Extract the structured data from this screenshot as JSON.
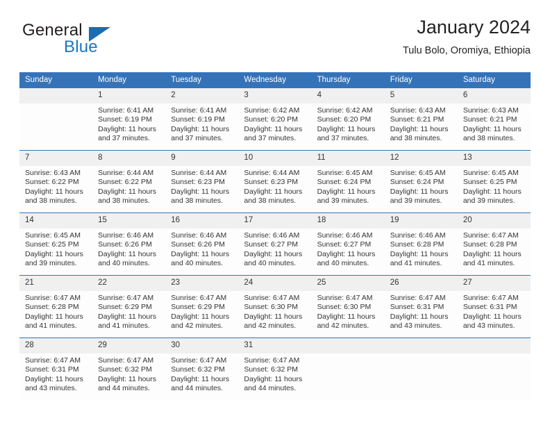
{
  "brand": {
    "word_one": "General",
    "word_two": "Blue",
    "icon": "triangle-logo-icon"
  },
  "header": {
    "title": "January 2024",
    "subtitle": "Tulu Bolo, Oromiya, Ethiopia"
  },
  "colors": {
    "header_blue": "#3573b9",
    "brand_blue": "#1b75bb",
    "daynum_band": "#f0f0f0",
    "text": "#333333"
  },
  "weekday_headers": [
    "Sunday",
    "Monday",
    "Tuesday",
    "Wednesday",
    "Thursday",
    "Friday",
    "Saturday"
  ],
  "labels": {
    "sunrise_prefix": "Sunrise:",
    "sunset_prefix": "Sunset:",
    "daylight_prefix": "Daylight:"
  },
  "weeks": [
    [
      {
        "day": "",
        "sunrise": "",
        "sunset": "",
        "daylight_line1": "",
        "daylight_line2": ""
      },
      {
        "day": "1",
        "sunrise": "Sunrise: 6:41 AM",
        "sunset": "Sunset: 6:19 PM",
        "daylight_line1": "Daylight: 11 hours",
        "daylight_line2": "and 37 minutes."
      },
      {
        "day": "2",
        "sunrise": "Sunrise: 6:41 AM",
        "sunset": "Sunset: 6:19 PM",
        "daylight_line1": "Daylight: 11 hours",
        "daylight_line2": "and 37 minutes."
      },
      {
        "day": "3",
        "sunrise": "Sunrise: 6:42 AM",
        "sunset": "Sunset: 6:20 PM",
        "daylight_line1": "Daylight: 11 hours",
        "daylight_line2": "and 37 minutes."
      },
      {
        "day": "4",
        "sunrise": "Sunrise: 6:42 AM",
        "sunset": "Sunset: 6:20 PM",
        "daylight_line1": "Daylight: 11 hours",
        "daylight_line2": "and 37 minutes."
      },
      {
        "day": "5",
        "sunrise": "Sunrise: 6:43 AM",
        "sunset": "Sunset: 6:21 PM",
        "daylight_line1": "Daylight: 11 hours",
        "daylight_line2": "and 38 minutes."
      },
      {
        "day": "6",
        "sunrise": "Sunrise: 6:43 AM",
        "sunset": "Sunset: 6:21 PM",
        "daylight_line1": "Daylight: 11 hours",
        "daylight_line2": "and 38 minutes."
      }
    ],
    [
      {
        "day": "7",
        "sunrise": "Sunrise: 6:43 AM",
        "sunset": "Sunset: 6:22 PM",
        "daylight_line1": "Daylight: 11 hours",
        "daylight_line2": "and 38 minutes."
      },
      {
        "day": "8",
        "sunrise": "Sunrise: 6:44 AM",
        "sunset": "Sunset: 6:22 PM",
        "daylight_line1": "Daylight: 11 hours",
        "daylight_line2": "and 38 minutes."
      },
      {
        "day": "9",
        "sunrise": "Sunrise: 6:44 AM",
        "sunset": "Sunset: 6:23 PM",
        "daylight_line1": "Daylight: 11 hours",
        "daylight_line2": "and 38 minutes."
      },
      {
        "day": "10",
        "sunrise": "Sunrise: 6:44 AM",
        "sunset": "Sunset: 6:23 PM",
        "daylight_line1": "Daylight: 11 hours",
        "daylight_line2": "and 38 minutes."
      },
      {
        "day": "11",
        "sunrise": "Sunrise: 6:45 AM",
        "sunset": "Sunset: 6:24 PM",
        "daylight_line1": "Daylight: 11 hours",
        "daylight_line2": "and 39 minutes."
      },
      {
        "day": "12",
        "sunrise": "Sunrise: 6:45 AM",
        "sunset": "Sunset: 6:24 PM",
        "daylight_line1": "Daylight: 11 hours",
        "daylight_line2": "and 39 minutes."
      },
      {
        "day": "13",
        "sunrise": "Sunrise: 6:45 AM",
        "sunset": "Sunset: 6:25 PM",
        "daylight_line1": "Daylight: 11 hours",
        "daylight_line2": "and 39 minutes."
      }
    ],
    [
      {
        "day": "14",
        "sunrise": "Sunrise: 6:45 AM",
        "sunset": "Sunset: 6:25 PM",
        "daylight_line1": "Daylight: 11 hours",
        "daylight_line2": "and 39 minutes."
      },
      {
        "day": "15",
        "sunrise": "Sunrise: 6:46 AM",
        "sunset": "Sunset: 6:26 PM",
        "daylight_line1": "Daylight: 11 hours",
        "daylight_line2": "and 40 minutes."
      },
      {
        "day": "16",
        "sunrise": "Sunrise: 6:46 AM",
        "sunset": "Sunset: 6:26 PM",
        "daylight_line1": "Daylight: 11 hours",
        "daylight_line2": "and 40 minutes."
      },
      {
        "day": "17",
        "sunrise": "Sunrise: 6:46 AM",
        "sunset": "Sunset: 6:27 PM",
        "daylight_line1": "Daylight: 11 hours",
        "daylight_line2": "and 40 minutes."
      },
      {
        "day": "18",
        "sunrise": "Sunrise: 6:46 AM",
        "sunset": "Sunset: 6:27 PM",
        "daylight_line1": "Daylight: 11 hours",
        "daylight_line2": "and 40 minutes."
      },
      {
        "day": "19",
        "sunrise": "Sunrise: 6:46 AM",
        "sunset": "Sunset: 6:28 PM",
        "daylight_line1": "Daylight: 11 hours",
        "daylight_line2": "and 41 minutes."
      },
      {
        "day": "20",
        "sunrise": "Sunrise: 6:47 AM",
        "sunset": "Sunset: 6:28 PM",
        "daylight_line1": "Daylight: 11 hours",
        "daylight_line2": "and 41 minutes."
      }
    ],
    [
      {
        "day": "21",
        "sunrise": "Sunrise: 6:47 AM",
        "sunset": "Sunset: 6:28 PM",
        "daylight_line1": "Daylight: 11 hours",
        "daylight_line2": "and 41 minutes."
      },
      {
        "day": "22",
        "sunrise": "Sunrise: 6:47 AM",
        "sunset": "Sunset: 6:29 PM",
        "daylight_line1": "Daylight: 11 hours",
        "daylight_line2": "and 41 minutes."
      },
      {
        "day": "23",
        "sunrise": "Sunrise: 6:47 AM",
        "sunset": "Sunset: 6:29 PM",
        "daylight_line1": "Daylight: 11 hours",
        "daylight_line2": "and 42 minutes."
      },
      {
        "day": "24",
        "sunrise": "Sunrise: 6:47 AM",
        "sunset": "Sunset: 6:30 PM",
        "daylight_line1": "Daylight: 11 hours",
        "daylight_line2": "and 42 minutes."
      },
      {
        "day": "25",
        "sunrise": "Sunrise: 6:47 AM",
        "sunset": "Sunset: 6:30 PM",
        "daylight_line1": "Daylight: 11 hours",
        "daylight_line2": "and 42 minutes."
      },
      {
        "day": "26",
        "sunrise": "Sunrise: 6:47 AM",
        "sunset": "Sunset: 6:31 PM",
        "daylight_line1": "Daylight: 11 hours",
        "daylight_line2": "and 43 minutes."
      },
      {
        "day": "27",
        "sunrise": "Sunrise: 6:47 AM",
        "sunset": "Sunset: 6:31 PM",
        "daylight_line1": "Daylight: 11 hours",
        "daylight_line2": "and 43 minutes."
      }
    ],
    [
      {
        "day": "28",
        "sunrise": "Sunrise: 6:47 AM",
        "sunset": "Sunset: 6:31 PM",
        "daylight_line1": "Daylight: 11 hours",
        "daylight_line2": "and 43 minutes."
      },
      {
        "day": "29",
        "sunrise": "Sunrise: 6:47 AM",
        "sunset": "Sunset: 6:32 PM",
        "daylight_line1": "Daylight: 11 hours",
        "daylight_line2": "and 44 minutes."
      },
      {
        "day": "30",
        "sunrise": "Sunrise: 6:47 AM",
        "sunset": "Sunset: 6:32 PM",
        "daylight_line1": "Daylight: 11 hours",
        "daylight_line2": "and 44 minutes."
      },
      {
        "day": "31",
        "sunrise": "Sunrise: 6:47 AM",
        "sunset": "Sunset: 6:32 PM",
        "daylight_line1": "Daylight: 11 hours",
        "daylight_line2": "and 44 minutes."
      },
      {
        "day": "",
        "sunrise": "",
        "sunset": "",
        "daylight_line1": "",
        "daylight_line2": ""
      },
      {
        "day": "",
        "sunrise": "",
        "sunset": "",
        "daylight_line1": "",
        "daylight_line2": ""
      },
      {
        "day": "",
        "sunrise": "",
        "sunset": "",
        "daylight_line1": "",
        "daylight_line2": ""
      }
    ]
  ]
}
